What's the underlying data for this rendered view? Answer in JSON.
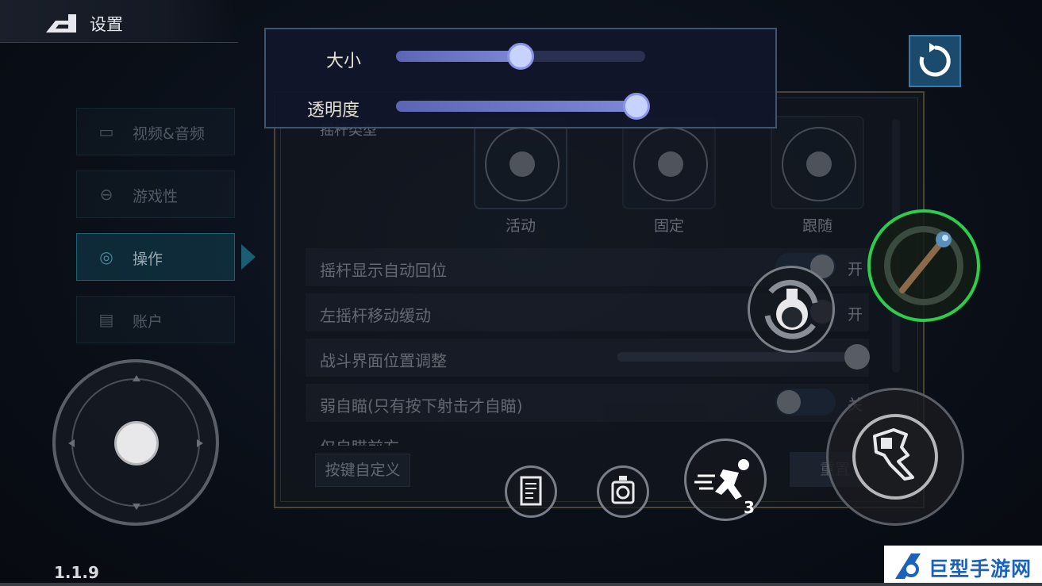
{
  "header": {
    "title": "设置"
  },
  "menu": {
    "items": [
      {
        "label": "视频&音频",
        "icon": "monitor-icon",
        "active": false
      },
      {
        "label": "游戏性",
        "icon": "gamepad-icon",
        "active": false
      },
      {
        "label": "操作",
        "icon": "crosshair-icon",
        "active": true
      },
      {
        "label": "账户",
        "icon": "document-icon",
        "active": false
      }
    ]
  },
  "popup": {
    "size_label": "大小",
    "size_value": 0.5,
    "opacity_label": "透明度",
    "opacity_value": 0.95
  },
  "panel": {
    "joystick_type_label": "摇杆类型",
    "joystick_types": [
      {
        "label": "活动",
        "selected": true
      },
      {
        "label": "固定",
        "selected": false
      },
      {
        "label": "跟随",
        "selected": false
      }
    ],
    "rows": [
      {
        "label": "摇杆显示自动回位",
        "control": "toggle",
        "state": "开"
      },
      {
        "label": "左摇杆移动缓动",
        "control": "toggle",
        "state": "开"
      },
      {
        "label": "战斗界面位置调整",
        "control": "slider",
        "value": 1.0
      },
      {
        "label": "弱自瞄(只有按下射击才自瞄)",
        "control": "toggle",
        "state": "关"
      },
      {
        "label": "仅自瞄前方",
        "control": "toggle",
        "state": ""
      }
    ],
    "custom_button": "按键自定义",
    "reset_button": "重置"
  },
  "hud": {
    "dash_charges": "3"
  },
  "version": "1.1.9",
  "watermark": {
    "text": "巨型手游网"
  },
  "colors": {
    "popup_fill": "#7e86d6",
    "active_menu": "#1c7e92",
    "weapon_ring": "#2ecc4e",
    "refresh_bg": "#1b4b6c"
  }
}
